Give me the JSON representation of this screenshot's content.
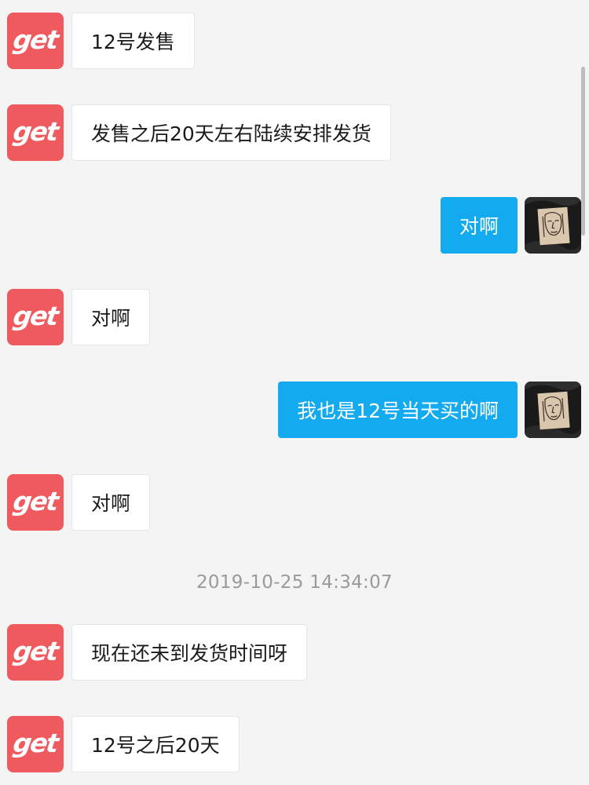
{
  "brand": {
    "color": "#ef5a5e",
    "logo_text": "get"
  },
  "accent_color": "#14aaf0",
  "timestamp": "2019-10-25 14:34:07",
  "messages": [
    {
      "sender": "get",
      "side": "left",
      "text": "12号发售"
    },
    {
      "sender": "get",
      "side": "left",
      "text": "发售之后20天左右陆续安排发货"
    },
    {
      "sender": "user",
      "side": "right",
      "text": "对啊"
    },
    {
      "sender": "get",
      "side": "left",
      "text": "对啊"
    },
    {
      "sender": "user",
      "side": "right",
      "text": "我也是12号当天买的啊"
    },
    {
      "sender": "get",
      "side": "left",
      "text": "对啊"
    },
    {
      "sender": "get",
      "side": "left",
      "text": "现在还未到发货时间呀"
    },
    {
      "sender": "get",
      "side": "left",
      "text": "12号之后20天"
    }
  ]
}
